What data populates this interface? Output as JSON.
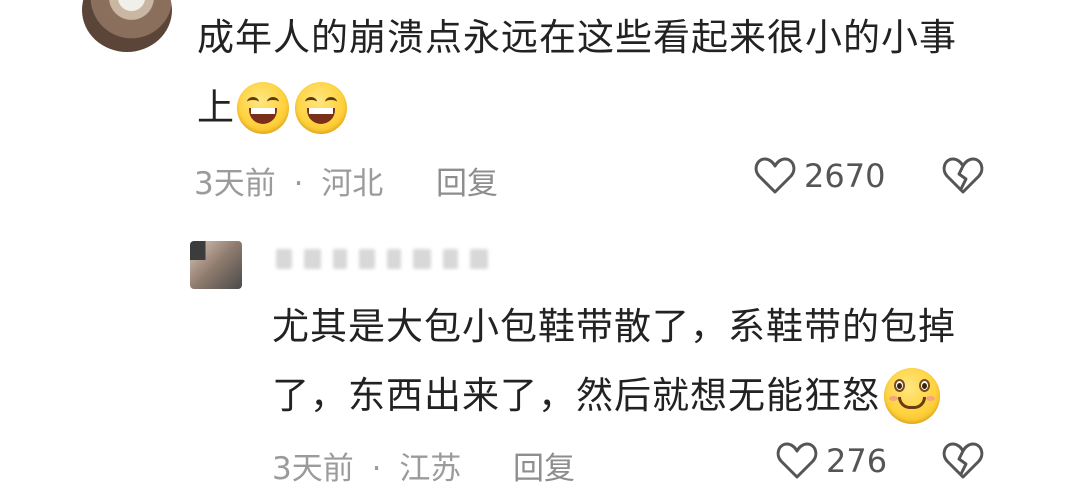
{
  "comments": [
    {
      "text_line1": "成年人的崩溃点永远在这些看起来很小的小事",
      "text_line2": "上",
      "emojis": [
        "grin-emoji",
        "grin-emoji"
      ],
      "time": "3天前",
      "separator": "·",
      "location": "河北",
      "reply_label": "回复",
      "likes": "2670"
    },
    {
      "text_line1": "尤其是大包小包鞋带散了，系鞋带的包掉",
      "text_line2": "了，东西出来了，然后就想无能狂怒",
      "emojis": [
        "smile-emoji"
      ],
      "time": "3天前",
      "separator": "·",
      "location": "江苏",
      "reply_label": "回复",
      "likes": "276"
    }
  ]
}
